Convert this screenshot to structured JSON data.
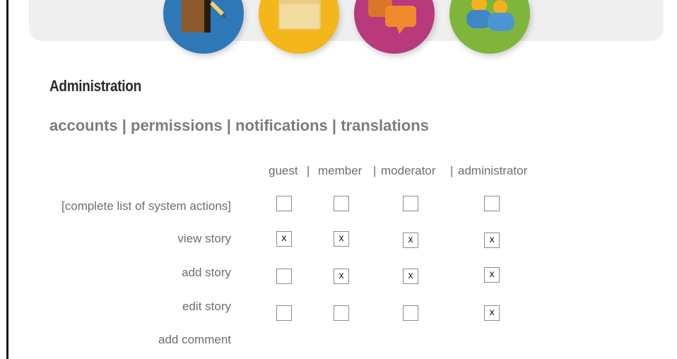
{
  "header": {
    "icons": [
      {
        "name": "notebook-icon",
        "color": "#2f78b8"
      },
      {
        "name": "folder-icon",
        "color": "#f4b71b"
      },
      {
        "name": "chat-bubbles-icon",
        "color": "#b8397c"
      },
      {
        "name": "users-icon",
        "color": "#7fb53b"
      }
    ]
  },
  "page": {
    "title": "Administration"
  },
  "tabs": [
    {
      "label": "accounts"
    },
    {
      "label": "permissions"
    },
    {
      "label": "notifications"
    },
    {
      "label": "translations"
    }
  ],
  "tab_separator": "|",
  "permissions": {
    "columns": [
      "guest",
      "member",
      "moderator",
      "administrator"
    ],
    "column_separator": "|",
    "rows": [
      {
        "label": "[complete list of system actions]",
        "checks": [
          "",
          "",
          "",
          ""
        ]
      },
      {
        "label": "view story",
        "checks": [
          "x",
          "x",
          "x",
          "x"
        ]
      },
      {
        "label": "add story",
        "checks": [
          "",
          "x",
          "x",
          "x"
        ]
      },
      {
        "label": "edit story",
        "checks": [
          "",
          "",
          "",
          "x"
        ]
      },
      {
        "label": "add comment",
        "checks": []
      }
    ]
  }
}
